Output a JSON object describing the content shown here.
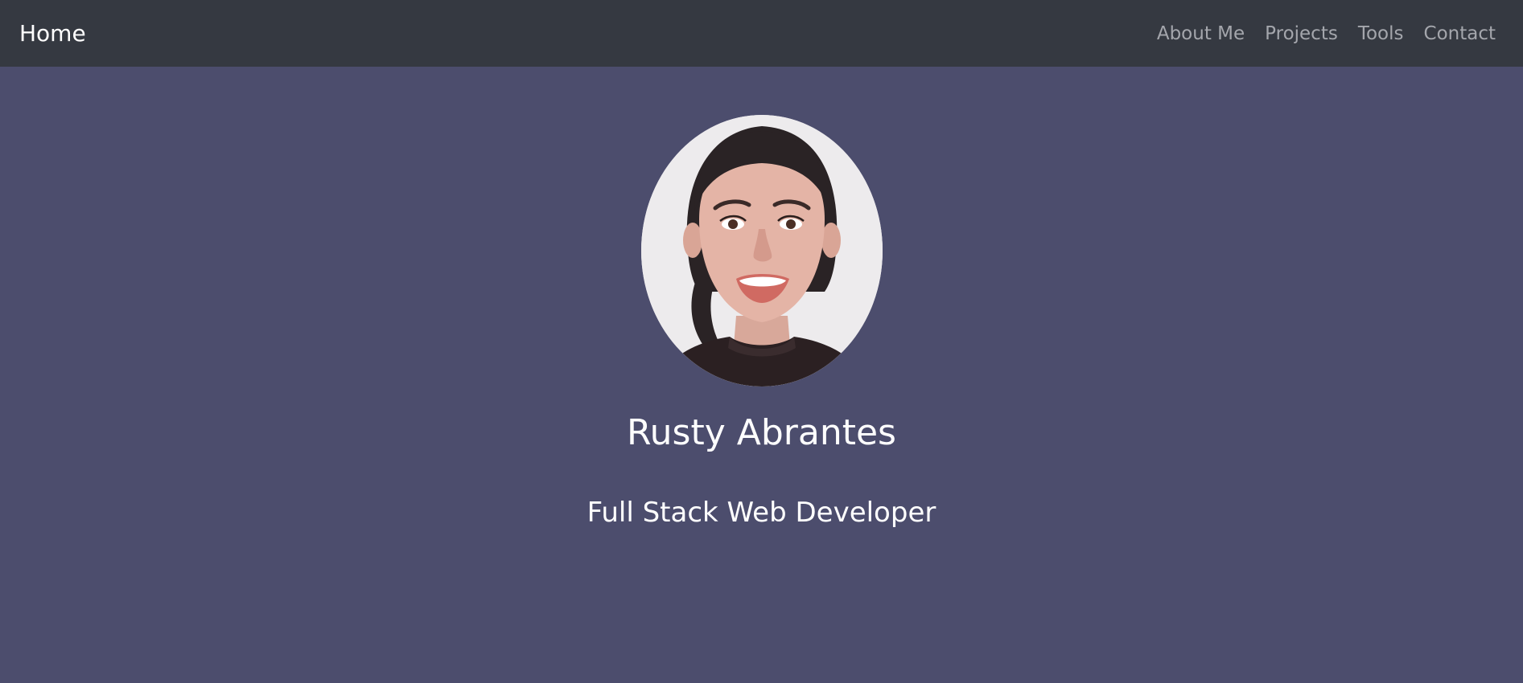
{
  "navbar": {
    "brand": "Home",
    "links": [
      {
        "label": "About Me"
      },
      {
        "label": "Projects"
      },
      {
        "label": "Tools"
      },
      {
        "label": "Contact"
      }
    ]
  },
  "hero": {
    "name": "Rusty Abrantes",
    "role": "Full Stack Web Developer",
    "avatar_alt": "profile-photo"
  },
  "colors": {
    "navbar_bg": "#353941",
    "page_bg": "#4c4d6d",
    "brand_text": "#ffffff",
    "nav_link_text": "#a4a6ac"
  }
}
